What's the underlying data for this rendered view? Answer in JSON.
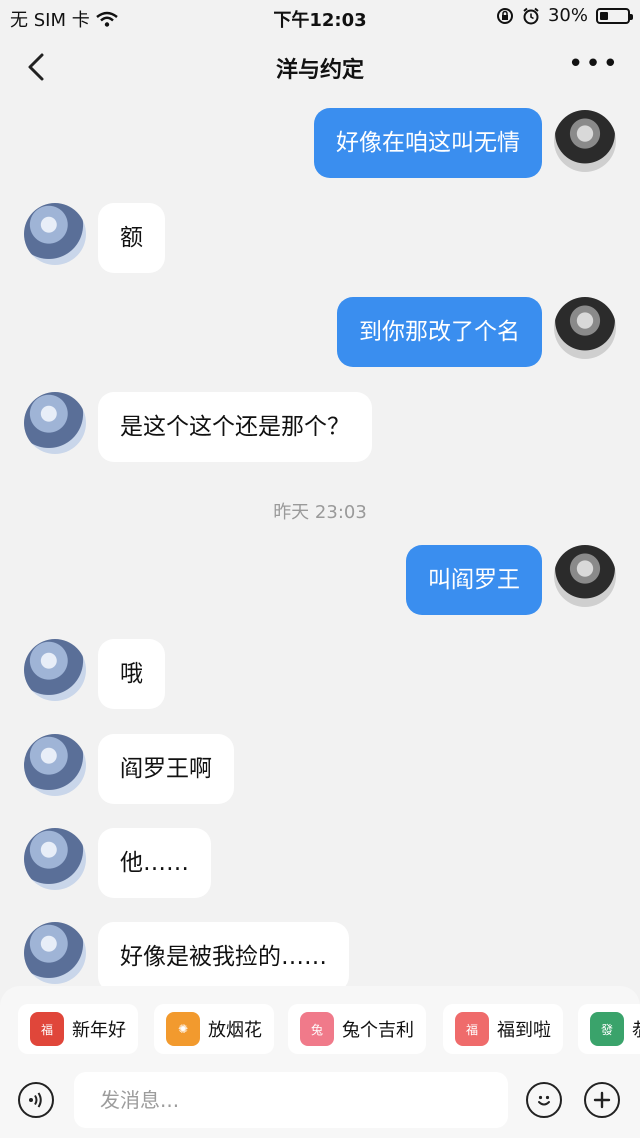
{
  "status": {
    "carrier": "无 SIM 卡",
    "time": "下午12:03",
    "battery": "30%",
    "battery_level": 0.3
  },
  "header": {
    "title": "洋与约定"
  },
  "messages": [
    {
      "from": "me",
      "text": "好像在咱这叫无情"
    },
    {
      "from": "them",
      "text": "额"
    },
    {
      "from": "me",
      "text": "到你那改了个名"
    },
    {
      "from": "them",
      "text": "是这个这个还是那个？"
    },
    {
      "timestamp": "昨天 23:03"
    },
    {
      "from": "me",
      "text": "叫阎罗王"
    },
    {
      "from": "them",
      "text": "哦"
    },
    {
      "from": "them",
      "text": "阎罗王啊"
    },
    {
      "from": "them",
      "text": "他……"
    },
    {
      "from": "them",
      "text": "好像是被我捡的……"
    }
  ],
  "quick_replies": [
    {
      "label": "新年好",
      "icon": "lion-dance-icon",
      "color": "#e0463a"
    },
    {
      "label": "放烟花",
      "icon": "firework-icon",
      "color": "#f29a2e"
    },
    {
      "label": "兔个吉利",
      "icon": "rabbit-icon",
      "color": "#f07a8a"
    },
    {
      "label": "福到啦",
      "icon": "lucky-pig-icon",
      "color": "#ef6b6b"
    },
    {
      "label": "恭",
      "icon": "mahjong-icon",
      "color": "#3aa36b"
    }
  ],
  "input": {
    "placeholder": "发消息..."
  },
  "colors": {
    "my_bubble": "#3a8eef",
    "their_bubble": "#ffffff",
    "background": "#f2f2f2"
  }
}
